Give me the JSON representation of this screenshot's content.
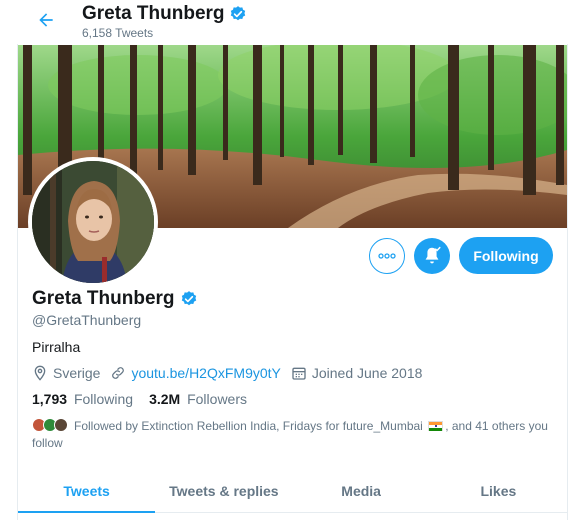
{
  "header": {
    "name": "Greta Thunberg",
    "tweet_count": "6,158 Tweets"
  },
  "profile": {
    "name": "Greta Thunberg",
    "handle": "@GretaThunberg",
    "bio": "Pirralha",
    "location": "Sverige",
    "link": "youtu.be/H2QxFM9y0tY",
    "joined": "Joined June 2018",
    "following_count": "1,793",
    "following_label": "Following",
    "followers_count": "3.2M",
    "followers_label": "Followers",
    "followed_by_text": "Followed by Extinction Rebellion India, Fridays for future_Mumbai",
    "followed_by_rest": ", and 41 others you follow"
  },
  "buttons": {
    "following_label": "Following"
  },
  "tabs": [
    {
      "label": "Tweets",
      "active": true
    },
    {
      "label": "Tweets & replies",
      "active": false
    },
    {
      "label": "Media",
      "active": false
    },
    {
      "label": "Likes",
      "active": false
    }
  ],
  "colors": {
    "accent": "#1da1f2",
    "link": "#1b95e0",
    "muted": "#657786",
    "text": "#14171a"
  },
  "icons": {
    "back": "arrow-left-icon",
    "verified": "verified-badge-icon",
    "more": "more-dots-icon",
    "notifications": "bell-icon",
    "location": "location-pin-icon",
    "link": "link-icon",
    "calendar": "calendar-icon"
  }
}
